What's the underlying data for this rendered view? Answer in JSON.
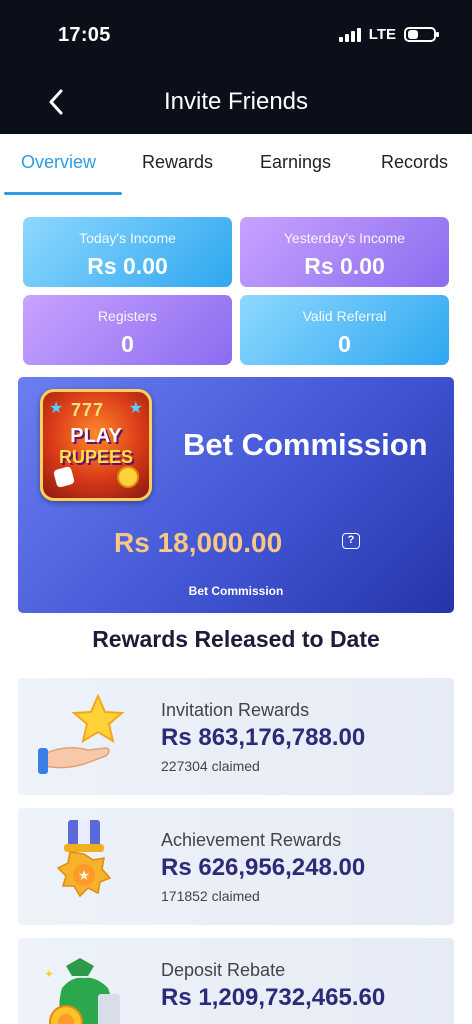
{
  "status": {
    "time": "17:05",
    "network": "LTE"
  },
  "nav": {
    "title": "Invite Friends"
  },
  "tabs": [
    "Overview",
    "Rewards",
    "Earnings",
    "Records"
  ],
  "stats": [
    {
      "label": "Today's Income",
      "value": "Rs 0.00"
    },
    {
      "label": "Yesterday's Income",
      "value": "Rs 0.00"
    },
    {
      "label": "Registers",
      "value": "0"
    },
    {
      "label": "Valid Referral",
      "value": "0"
    }
  ],
  "commission": {
    "logo_line1": "PLAY",
    "logo_line2": "RUPEES",
    "logo_slots": "777",
    "title": "Bet Commission",
    "amount": "Rs 18,000.00",
    "help": "?",
    "label": "Bet Commission"
  },
  "section_title": "Rewards Released to Date",
  "rewards": [
    {
      "name": "Invitation Rewards",
      "amount": "Rs 863,176,788.00",
      "claimed": "227304 claimed",
      "icon": "hand-star-icon"
    },
    {
      "name": "Achievement Rewards",
      "amount": "Rs 626,956,248.00",
      "claimed": "171852 claimed",
      "icon": "medal-icon"
    },
    {
      "name": "Deposit Rebate",
      "amount": "Rs 1,209,732,465.60",
      "claimed": "",
      "icon": "money-bag-icon"
    }
  ],
  "colors": {
    "accent": "#2b9de0",
    "header_bg": "#0b0f1a",
    "amount_gold": "#f7c786",
    "amount_navy": "#2e2a7a"
  }
}
